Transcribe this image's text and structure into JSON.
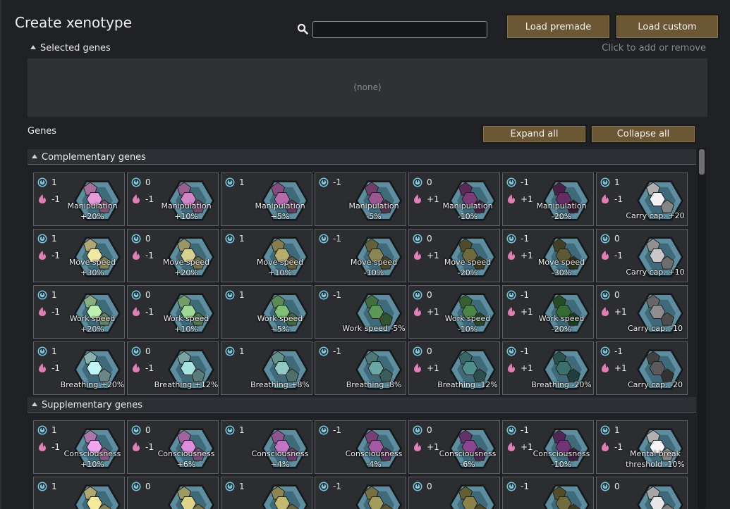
{
  "header": {
    "title": "Create xenotype",
    "search": {
      "value": "",
      "placeholder": ""
    },
    "load_premade_label": "Load premade",
    "load_custom_label": "Load custom"
  },
  "selected": {
    "label": "Selected genes",
    "hint": "Click to add or remove",
    "empty_text": "(none)"
  },
  "genes": {
    "label": "Genes",
    "expand_all_label": "Expand all",
    "collapse_all_label": "Collapse all",
    "categories": [
      {
        "name": "Complementary genes",
        "rows": [
          [
            {
              "cx": "1",
              "met": "-1",
              "label": "Manipulation\n+20%",
              "color": "#e79ad9"
            },
            {
              "cx": "0",
              "met": "-1",
              "label": "Manipulation\n+10%",
              "color": "#d286c8"
            },
            {
              "cx": "1",
              "met": "",
              "label": "Manipulation\n+5%",
              "color": "#b86aae"
            },
            {
              "cx": "-1",
              "met": "",
              "label": "Manipulation\n-5%",
              "color": "#9a5893"
            },
            {
              "cx": "0",
              "met": "+1",
              "label": "Manipulation\n-10%",
              "color": "#7b3b76"
            },
            {
              "cx": "-1",
              "met": "+1",
              "label": "Manipulation\n-20%",
              "color": "#652d61"
            },
            {
              "cx": "1",
              "met": "-1",
              "label": "Carry cap. +20",
              "color": "#f2f2f2"
            }
          ],
          [
            {
              "cx": "1",
              "met": "-1",
              "label": "Move speed\n+30%",
              "color": "#f0e9a4"
            },
            {
              "cx": "0",
              "met": "-1",
              "label": "Move speed\n+20%",
              "color": "#d8d08e"
            },
            {
              "cx": "1",
              "met": "",
              "label": "Move speed\n+10%",
              "color": "#b7ad6c"
            },
            {
              "cx": "-1",
              "met": "",
              "label": "Move speed\n-10%",
              "color": "#8c8654"
            },
            {
              "cx": "0",
              "met": "+1",
              "label": "Move speed\n-20%",
              "color": "#6e6a3e"
            },
            {
              "cx": "-1",
              "met": "+1",
              "label": "Move speed\n-30%",
              "color": "#5c5934"
            },
            {
              "cx": "0",
              "met": "-1",
              "label": "Carry cap. +10",
              "color": "#c8c8c8"
            }
          ],
          [
            {
              "cx": "1",
              "met": "-1",
              "label": "Work speed\n+20%",
              "color": "#bdf0b0"
            },
            {
              "cx": "0",
              "met": "-1",
              "label": "Work speed\n+10%",
              "color": "#9fd894"
            },
            {
              "cx": "1",
              "met": "",
              "label": "Work speed\n+5%",
              "color": "#7fbf76"
            },
            {
              "cx": "-1",
              "met": "",
              "label": "Work speed -5%",
              "color": "#5d9857"
            },
            {
              "cx": "0",
              "met": "+1",
              "label": "Work speed\n-10%",
              "color": "#4a8447"
            },
            {
              "cx": "-1",
              "met": "+1",
              "label": "Work speed\n-20%",
              "color": "#346b34"
            },
            {
              "cx": "0",
              "met": "+1",
              "label": "Carry cap. -10",
              "color": "#8e8e8e"
            }
          ],
          [
            {
              "cx": "1",
              "met": "-1",
              "label": "Breathing +20%",
              "color": "#bff5f2"
            },
            {
              "cx": "0",
              "met": "-1",
              "label": "Breathing +12%",
              "color": "#a6e2df"
            },
            {
              "cx": "1",
              "met": "",
              "label": "Breathing +8%",
              "color": "#8fc9c6"
            },
            {
              "cx": "-1",
              "met": "",
              "label": "Breathing -8%",
              "color": "#6aa8a4"
            },
            {
              "cx": "0",
              "met": "+1",
              "label": "Breathing -12%",
              "color": "#4f8f8b"
            },
            {
              "cx": "-1",
              "met": "+1",
              "label": "Breathing -20%",
              "color": "#3a716c"
            },
            {
              "cx": "-1",
              "met": "+1",
              "label": "Carry cap. -20",
              "color": "#5a5a5a"
            }
          ]
        ]
      },
      {
        "name": "Supplementary genes",
        "rows": [
          [
            {
              "cx": "1",
              "met": "-1",
              "label": "Consciousness\n+10%",
              "color": "#f0a4ef"
            },
            {
              "cx": "0",
              "met": "-1",
              "label": "Consciousness\n+6%",
              "color": "#de8cdc"
            },
            {
              "cx": "1",
              "met": "",
              "label": "Consciousness\n+4%",
              "color": "#c474c4"
            },
            {
              "cx": "-1",
              "met": "",
              "label": "Consciousness\n-4%",
              "color": "#a35aa5"
            },
            {
              "cx": "0",
              "met": "+1",
              "label": "Consciousness\n-6%",
              "color": "#8a4590"
            },
            {
              "cx": "-1",
              "met": "+1",
              "label": "Consciousness\n-10%",
              "color": "#6f3574"
            },
            {
              "cx": "1",
              "met": "-1",
              "label": "Mental break\nthreshold -10%",
              "color": "#f5f5f5"
            }
          ],
          [
            {
              "cx": "1",
              "met": "",
              "label": "",
              "color": "#f3ea9c"
            },
            {
              "cx": "0",
              "met": "",
              "label": "",
              "color": "#ddd48a"
            },
            {
              "cx": "1",
              "met": "",
              "label": "",
              "color": "#c3ba72"
            },
            {
              "cx": "-1",
              "met": "",
              "label": "",
              "color": "#a49c5c"
            },
            {
              "cx": "0",
              "met": "",
              "label": "",
              "color": "#8a8248"
            },
            {
              "cx": "-1",
              "met": "",
              "label": "",
              "color": "#726b3c"
            },
            {
              "cx": "0",
              "met": "",
              "label": "",
              "color": "#e6e6e6"
            }
          ]
        ]
      }
    ]
  }
}
